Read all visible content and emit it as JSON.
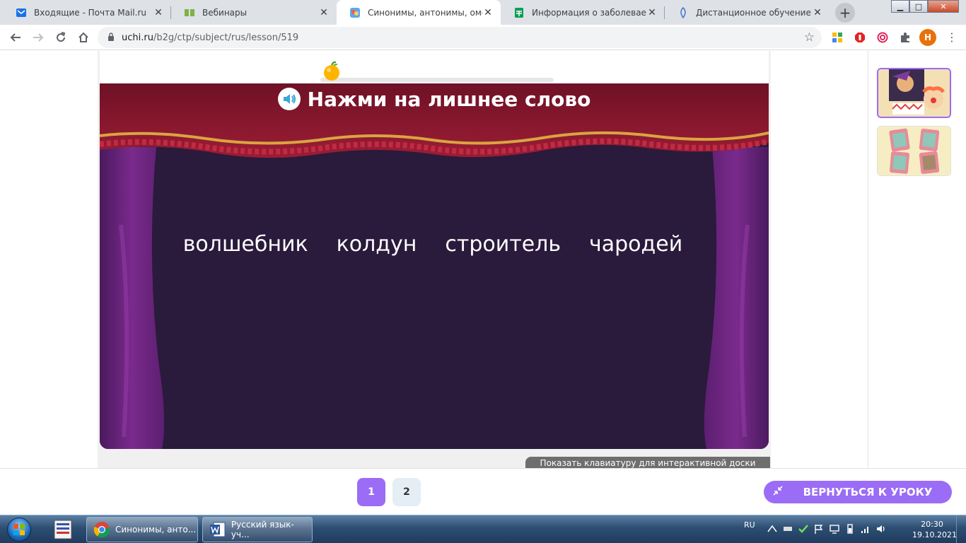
{
  "browser": {
    "tabs": [
      {
        "title": "Входящие - Почта Mail.ru",
        "close": "✕",
        "active": false
      },
      {
        "title": "Вебинары",
        "close": "✕",
        "active": false
      },
      {
        "title": "Синонимы, антонимы, омоним",
        "close": "✕",
        "active": true
      },
      {
        "title": "Информация о заболеваемост",
        "close": "✕",
        "active": false
      },
      {
        "title": "Дистанционное обучение МО",
        "close": "✕",
        "active": false
      }
    ],
    "new_tab": "+",
    "window_controls": {
      "minimize": "▁",
      "maximize": "□",
      "close": "✕"
    },
    "url": {
      "host": "uchi.ru",
      "path": "/b2g/ctp/subject/rus/lesson/519"
    },
    "profile_initial": "H"
  },
  "exercise": {
    "instruction": "Нажми на лишнее слово",
    "words": [
      "волшебник",
      "колдун",
      "строитель",
      "чародей"
    ],
    "keyboard_button": "Показать клавиатуру для интерактивной доски",
    "progress": 0
  },
  "pagination": {
    "pages": [
      "1",
      "2"
    ],
    "current": "1"
  },
  "back_button": "ВЕРНУТЬСЯ К УРОКУ",
  "taskbar": {
    "tasks": [
      {
        "label": "Синонимы, анто..."
      },
      {
        "label": "Русский язык-уч..."
      }
    ],
    "language": "RU",
    "time": "20:30",
    "date": "19.10.2021"
  },
  "colors": {
    "accent": "#9b6cf5",
    "curtain_red": "#8a1730",
    "stage_bg": "#2a1a3c"
  }
}
